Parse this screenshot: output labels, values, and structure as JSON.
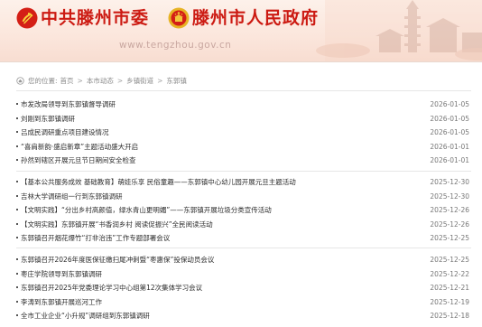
{
  "header": {
    "party_committee": "中共滕州市委",
    "government": "滕州市人民政府",
    "url": "www.tengzhou.gov.cn",
    "party_emblem_icon": "party-emblem-icon",
    "state_emblem_icon": "national-emblem-icon",
    "brand_color": "#cc1a12"
  },
  "breadcrumb": {
    "prefix": "您的位置:",
    "items": [
      "首页",
      "本市动态",
      "乡镇街道",
      "东郭镇"
    ],
    "separator": ">"
  },
  "groups": [
    [
      {
        "title": "市发改局领导到东郭镇督导调研",
        "date": "2026-01-05"
      },
      {
        "title": "刘刚到东郭镇调研",
        "date": "2026-01-05"
      },
      {
        "title": "吕成民调研重点项目建设情况",
        "date": "2026-01-05"
      },
      {
        "title": "“喜肩新韵·盛启新章”主题活动盛大开启",
        "date": "2026-01-01"
      },
      {
        "title": "孙然到辖区开展元旦节日期间安全检查",
        "date": "2026-01-01"
      }
    ],
    [
      {
        "title": "【基本公共服务成效 基础教育】萌娃乐享 民俗童趣——东郭镇中心幼儿园开展元旦主题活动",
        "date": "2025-12-30"
      },
      {
        "title": "吉林大学调研组一行到东郭镇调研",
        "date": "2025-12-30"
      },
      {
        "title": "【文明实践】“分出乡村高颜值，绿水青山更明媚”——东郭镇开展垃圾分类宣传活动",
        "date": "2025-12-26"
      },
      {
        "title": "【文明实践】东郭镇开展“书香润乡村 阅读促振兴”全民阅读活动",
        "date": "2025-12-26"
      },
      {
        "title": "东郭镇召开烟花爆竹“打非治违”工作专题部署会议",
        "date": "2025-12-25"
      }
    ],
    [
      {
        "title": "东郭镇召开2026年度医保征缴扫尾冲刺暨“枣惠保”投保动员会议",
        "date": "2025-12-25"
      },
      {
        "title": "枣庄学院领导到东郭镇调研",
        "date": "2025-12-22"
      },
      {
        "title": "东郭镇召开2025年党委理论学习中心组第12次集体学习会议",
        "date": "2025-12-21"
      },
      {
        "title": "李涛到东郭镇开展巡河工作",
        "date": "2025-12-19"
      },
      {
        "title": "全市工业企业“小升规”调研组到东郭镇调研",
        "date": "2025-12-18"
      }
    ]
  ]
}
